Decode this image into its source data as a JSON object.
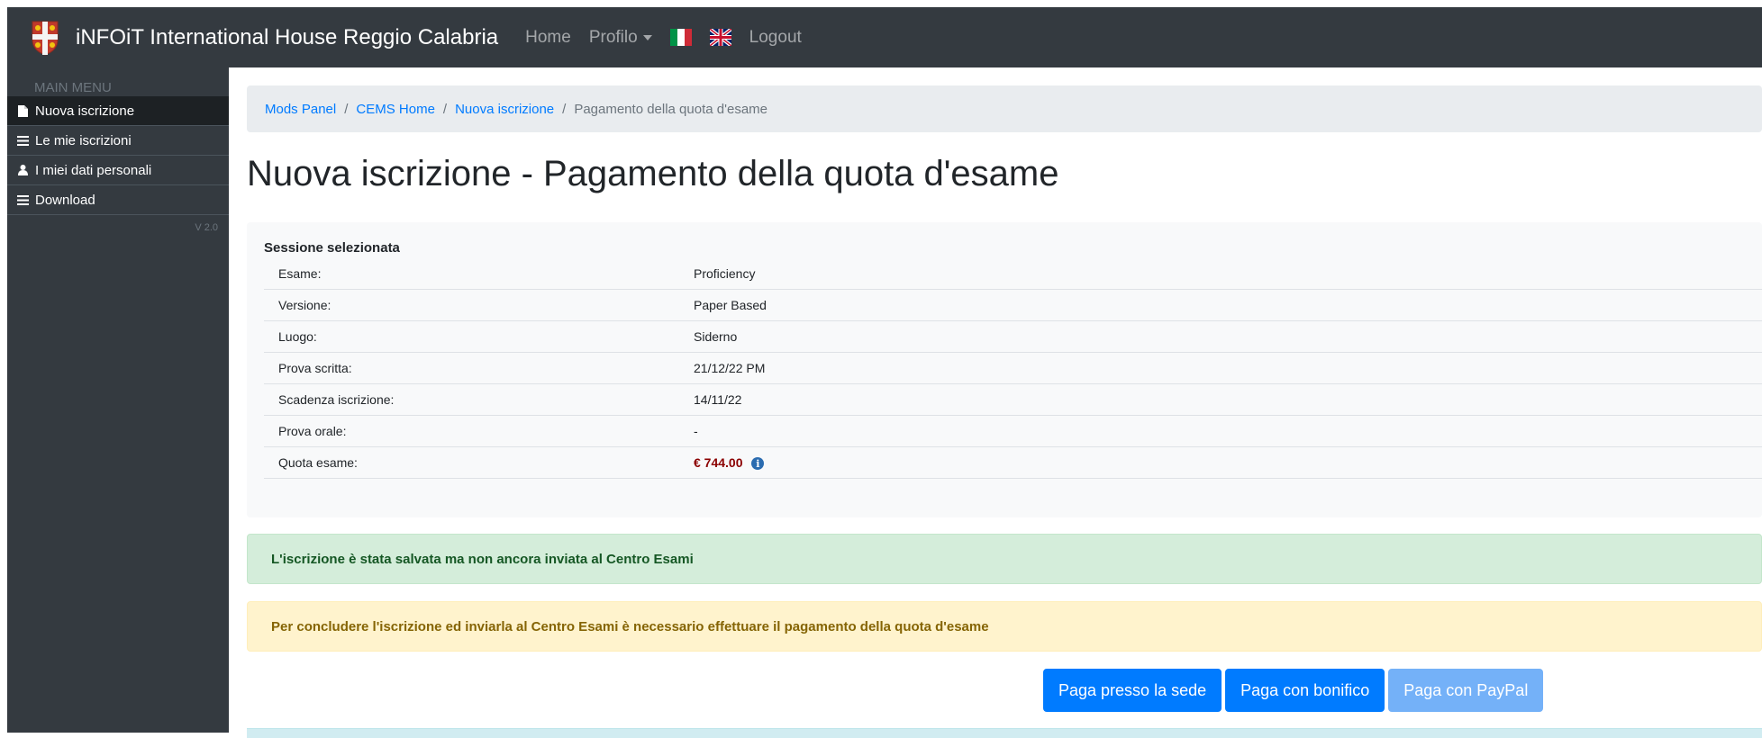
{
  "navbar": {
    "brand": "iNFOiT International House Reggio Calabria",
    "home": "Home",
    "profilo": "Profilo",
    "logout": "Logout"
  },
  "sidebar": {
    "header": "MAIN MENU",
    "items": [
      {
        "label": "Nuova iscrizione",
        "icon": "document-icon",
        "active": true
      },
      {
        "label": "Le mie iscrizioni",
        "icon": "list-icon",
        "active": false
      },
      {
        "label": "I miei dati personali",
        "icon": "user-icon",
        "active": false
      },
      {
        "label": "Download",
        "icon": "list-icon",
        "active": false
      }
    ],
    "version": "V 2.0"
  },
  "breadcrumb": {
    "items": [
      "Mods Panel",
      "CEMS Home",
      "Nuova iscrizione"
    ],
    "active": "Pagamento della quota d'esame"
  },
  "page_title": "Nuova iscrizione - Pagamento della quota d'esame",
  "session": {
    "title": "Sessione selezionata",
    "rows": [
      {
        "label": "Esame:",
        "value": "Proficiency"
      },
      {
        "label": "Versione:",
        "value": "Paper Based"
      },
      {
        "label": "Luogo:",
        "value": "Siderno"
      },
      {
        "label": "Prova scritta:",
        "value": "21/12/22 PM"
      },
      {
        "label": "Scadenza iscrizione:",
        "value": "14/11/22"
      },
      {
        "label": "Prova orale:",
        "value": "-"
      },
      {
        "label": "Quota esame:",
        "value": "€ 744.00"
      }
    ]
  },
  "alerts": {
    "success": "L'iscrizione è stata salvata ma non ancora inviata al Centro Esami",
    "warning": "Per concludere l'iscrizione ed inviarla al Centro Esami è necessario effettuare il pagamento della quota d'esame"
  },
  "buttons": {
    "sede": "Paga presso la sede",
    "bonifico": "Paga con bonifico",
    "paypal": "Paga con PayPal"
  },
  "colors": {
    "navbar": "#343a40",
    "primary": "#007bff",
    "quota": "#8b0000"
  }
}
